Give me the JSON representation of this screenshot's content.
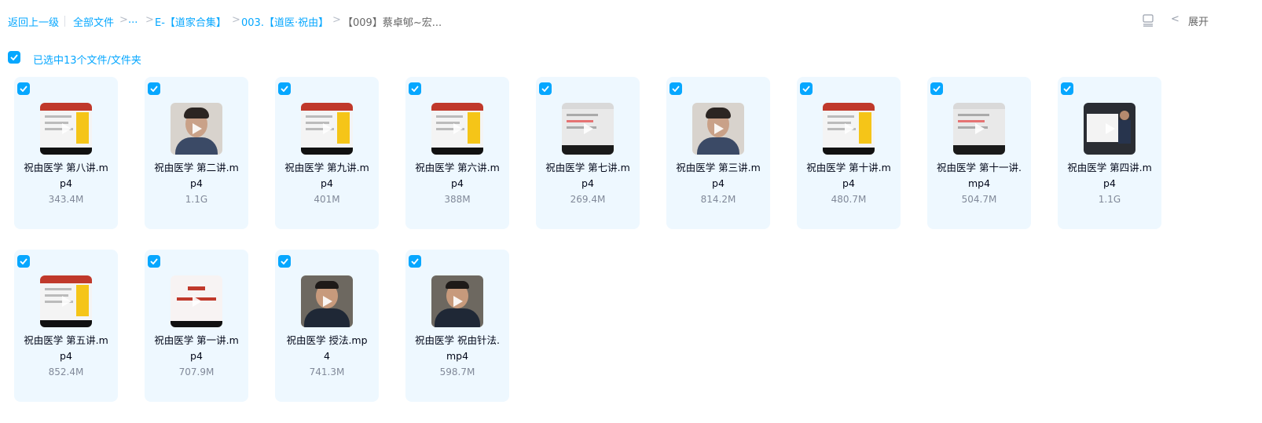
{
  "breadcrumb": {
    "back": "返回上一级",
    "all_files": "全部文件",
    "ellipsis": "...",
    "e_folder": "E-【道家合集】",
    "folder_003": "003.【道医·祝由】",
    "current": "【009】蔡卓郇~宏..."
  },
  "toolbar": {
    "expand_label": "展开"
  },
  "selection": {
    "label": "已选中13个文件/文件夹"
  },
  "colors": {
    "accent": "#06a7ff",
    "card_bg": "#eef8ff"
  },
  "files": [
    {
      "name_line1": "祝由医学 第八讲.m",
      "name_line2": "p4",
      "size": "343.4M",
      "thumb": "slide-red-yellow"
    },
    {
      "name_line1": "祝由医学 第二讲.m",
      "name_line2": "p4",
      "size": "1.1G",
      "thumb": "person"
    },
    {
      "name_line1": "祝由医学 第九讲.m",
      "name_line2": "p4",
      "size": "401M",
      "thumb": "slide-red-yellow"
    },
    {
      "name_line1": "祝由医学 第六讲.m",
      "name_line2": "p4",
      "size": "388M",
      "thumb": "slide-red-yellow"
    },
    {
      "name_line1": "祝由医学 第七讲.m",
      "name_line2": "p4",
      "size": "269.4M",
      "thumb": "slide-gray"
    },
    {
      "name_line1": "祝由医学 第三讲.m",
      "name_line2": "p4",
      "size": "814.2M",
      "thumb": "person"
    },
    {
      "name_line1": "祝由医学 第十讲.m",
      "name_line2": "p4",
      "size": "480.7M",
      "thumb": "slide-red-yellow"
    },
    {
      "name_line1": "祝由医学 第十一讲.",
      "name_line2": "mp4",
      "size": "504.7M",
      "thumb": "slide-gray"
    },
    {
      "name_line1": "祝由医学 第四讲.m",
      "name_line2": "p4",
      "size": "1.1G",
      "thumb": "whiteboard"
    },
    {
      "name_line1": "祝由医学 第五讲.m",
      "name_line2": "p4",
      "size": "852.4M",
      "thumb": "slide-red-yellow"
    },
    {
      "name_line1": "祝由医学 第一讲.m",
      "name_line2": "p4",
      "size": "707.9M",
      "thumb": "title-slide"
    },
    {
      "name_line1": "祝由医学 授法.mp",
      "name_line2": "4",
      "size": "741.3M",
      "thumb": "person-dark"
    },
    {
      "name_line1": "祝由医学 祝由针法.",
      "name_line2": "mp4",
      "size": "598.7M",
      "thumb": "person-dark"
    }
  ]
}
